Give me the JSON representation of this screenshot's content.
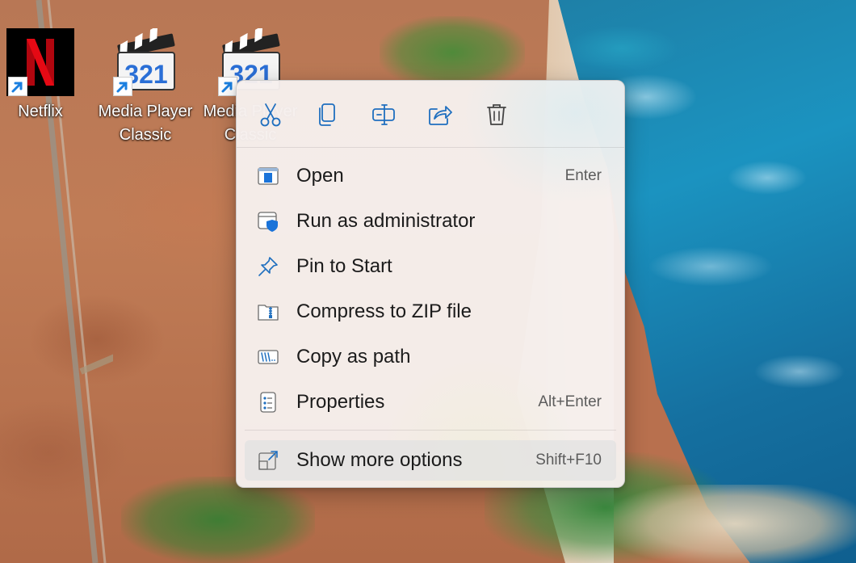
{
  "desktop": {
    "icons": [
      {
        "label": "Netflix"
      },
      {
        "label": "Media Player Classic"
      },
      {
        "label": "Media Player Classic"
      }
    ],
    "mpc_badge": "321"
  },
  "context_menu": {
    "quick_actions": [
      {
        "icon": "cut-icon"
      },
      {
        "icon": "copy-icon"
      },
      {
        "icon": "rename-icon"
      },
      {
        "icon": "share-icon"
      },
      {
        "icon": "delete-icon"
      }
    ],
    "items": [
      {
        "label": "Open",
        "shortcut": "Enter",
        "icon": "open-icon"
      },
      {
        "label": "Run as administrator",
        "shortcut": "",
        "icon": "run-as-admin-icon"
      },
      {
        "label": "Pin to Start",
        "shortcut": "",
        "icon": "pin-icon"
      },
      {
        "label": "Compress to ZIP file",
        "shortcut": "",
        "icon": "zip-folder-icon"
      },
      {
        "label": "Copy as path",
        "shortcut": "",
        "icon": "copy-path-icon"
      },
      {
        "label": "Properties",
        "shortcut": "Alt+Enter",
        "icon": "properties-icon"
      }
    ],
    "more_options": {
      "label": "Show more options",
      "shortcut": "Shift+F10",
      "icon": "show-more-icon"
    },
    "accent_color": "#0067c0",
    "highlight_color": "#e1e1e1"
  }
}
